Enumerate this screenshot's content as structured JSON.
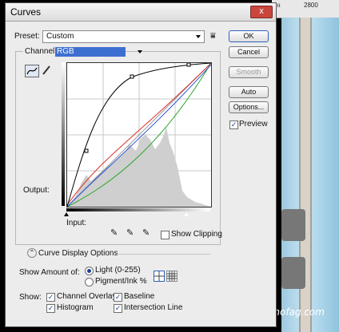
{
  "ruler": {
    "mark": "2800"
  },
  "window": {
    "title": "Curves",
    "close_glyph": "x"
  },
  "preset": {
    "label": "Preset:",
    "value": "Custom"
  },
  "channel": {
    "label": "Channel:",
    "value": "RGB"
  },
  "buttons": {
    "ok": "OK",
    "cancel": "Cancel",
    "smooth": "Smooth",
    "auto": "Auto",
    "options": "Options..."
  },
  "preview": {
    "label": "Preview",
    "checked": true
  },
  "graph": {
    "output_label": "Output:",
    "input_label": "Input:"
  },
  "show_clipping": {
    "label": "Show Clipping",
    "checked": false
  },
  "curve_display": {
    "label": "Curve Display Options"
  },
  "show_amount": {
    "label": "Show Amount of:",
    "light": "Light  (0-255)",
    "pigment": "Pigment/Ink %",
    "selected": "light"
  },
  "show": {
    "label": "Show:",
    "channel_overlays": "Channel Overlays",
    "baseline": "Baseline",
    "histogram": "Histogram",
    "intersection_line": "Intersection Line"
  },
  "watermark": "www.hronofag.com",
  "colors": {
    "accent": "#2c63b8",
    "channel_highlight": "#3d6fd0",
    "red": "#d9302b",
    "green": "#2aa52c",
    "blue": "#2b4fd6"
  },
  "icons": [
    "preset-menu-icon",
    "curve-point-tool-icon",
    "pencil-tool-icon",
    "black-eyedropper-icon",
    "gray-eyedropper-icon",
    "white-eyedropper-icon",
    "expand-chevron-icon",
    "simple-grid-icon",
    "detailed-grid-icon"
  ]
}
